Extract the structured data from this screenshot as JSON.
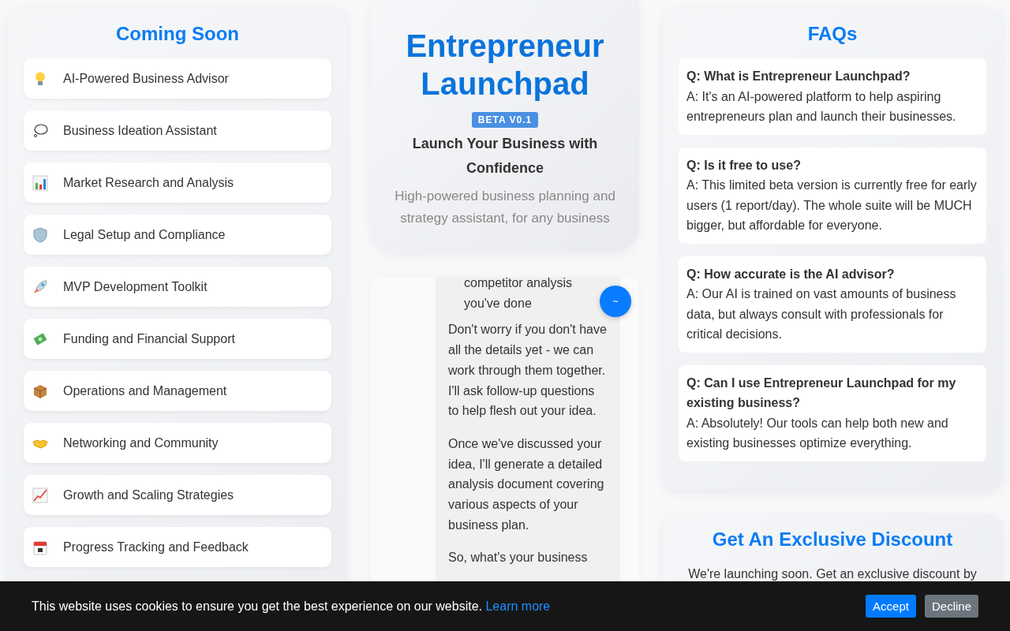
{
  "coming_soon": {
    "title": "Coming Soon",
    "items": [
      {
        "label": "AI-Powered Business Advisor"
      },
      {
        "label": "Business Ideation Assistant"
      },
      {
        "label": "Market Research and Analysis"
      },
      {
        "label": "Legal Setup and Compliance"
      },
      {
        "label": "MVP Development Toolkit"
      },
      {
        "label": "Funding and Financial Support"
      },
      {
        "label": "Operations and Management"
      },
      {
        "label": "Networking and Community"
      },
      {
        "label": "Growth and Scaling Strategies"
      },
      {
        "label": "Progress Tracking and Feedback"
      }
    ]
  },
  "hero": {
    "title": "Entrepreneur Launchpad",
    "badge": "BETA V0.1",
    "subtitle": "Launch Your Business with Confidence",
    "description": "High-powered business planning and strategy assistant, for any business"
  },
  "chat": {
    "list_item": "competitor analysis you've done",
    "paragraphs": [
      "Don't worry if you don't have all the details yet - we can work through them together. I'll ask follow-up questions to help flesh out your idea.",
      "Once we've discussed your idea, I'll generate a detailed analysis document covering various aspects of your business plan.",
      "So, what's your business"
    ],
    "toggle": "~"
  },
  "faqs": {
    "title": "FAQs",
    "items": [
      {
        "question": "Q: What is Entrepreneur Launchpad?",
        "answer": "A: It's an AI-powered platform to help aspiring entrepreneurs plan and launch their businesses."
      },
      {
        "question": "Q: Is it free to use?",
        "answer": "A: This limited beta version is currently free for early users (1 report/day). The whole suite will be MUCH bigger, but affordable for everyone."
      },
      {
        "question": "Q: How accurate is the AI advisor?",
        "answer": "A: Our AI is trained on vast amounts of business data, but always consult with professionals for critical decisions."
      },
      {
        "question": "Q: Can I use Entrepreneur Launchpad for my existing business?",
        "answer": "A: Absolutely! Our tools can help both new and existing businesses optimize everything."
      }
    ]
  },
  "discount": {
    "title": "Get An Exclusive Discount",
    "text": "We're launching soon. Get an exclusive discount by"
  },
  "cookie_bar": {
    "text": "This website uses cookies to ensure you get the best experience on our website.",
    "link": "Learn more",
    "buttons": [
      {
        "label": "Accept",
        "kind": "primary"
      },
      {
        "label": "Decline",
        "kind": "secondary"
      }
    ]
  }
}
